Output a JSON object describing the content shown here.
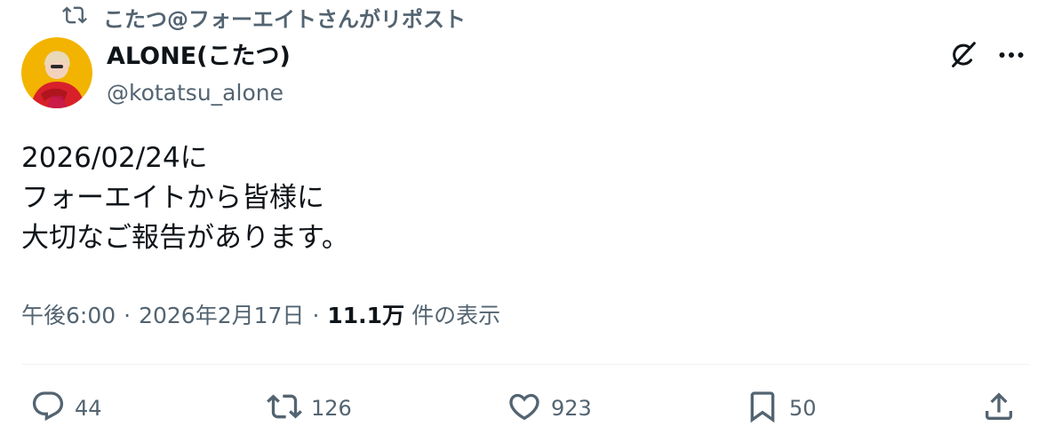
{
  "repost": {
    "icon": "retweet-icon",
    "text": "こたつ@フォーエイトさんがリポスト"
  },
  "author": {
    "display_name": "ALONE(こたつ)",
    "handle": "@kotatsu_alone",
    "avatar_icon": "avatar"
  },
  "header_actions": {
    "grok_icon": "grok-icon",
    "more_icon": "more-icon"
  },
  "tweet": {
    "lines": [
      "2026/02/24に",
      "フォーエイトから皆様に",
      "大切なご報告があります。"
    ]
  },
  "meta": {
    "time": "午後6:00",
    "separator": "·",
    "date": "2026年2月17日",
    "views_count": "11.1万",
    "views_label": "件の表示"
  },
  "actions": {
    "reply": {
      "icon": "reply-icon",
      "count": "44"
    },
    "retweet": {
      "icon": "retweet-icon",
      "count": "126"
    },
    "like": {
      "icon": "heart-icon",
      "count": "923"
    },
    "bookmark": {
      "icon": "bookmark-icon",
      "count": "50"
    },
    "share": {
      "icon": "share-icon"
    }
  },
  "colors": {
    "text_primary": "#0f1419",
    "text_secondary": "#536471",
    "divider": "#eff3f4",
    "avatar_background": "#f2b400",
    "avatar_shirt": "#d8202a"
  }
}
